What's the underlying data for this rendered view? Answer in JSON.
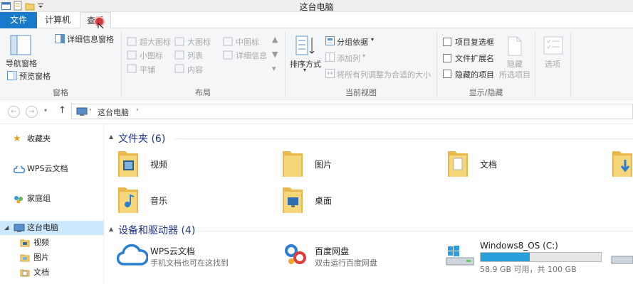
{
  "window": {
    "title": "这台电脑"
  },
  "ribbon_tabs": {
    "file": "文件",
    "computer": "计算机",
    "view": "查看"
  },
  "ribbon": {
    "panes": {
      "nav_pane": "导航窗格",
      "preview_pane": "预览窗格",
      "details_pane": "详细信息窗格",
      "group_label": "窗格"
    },
    "layout": {
      "items": [
        "超大图标",
        "大图标",
        "中图标",
        "小图标",
        "列表",
        "详细信息",
        "平铺",
        "内容"
      ],
      "group_label": "布局"
    },
    "current_view": {
      "sort_by": "排序方式",
      "group_by": "分组依据",
      "add_column": "添加列",
      "fit_columns": "将所有列调整为合适的大小",
      "group_label": "当前视图"
    },
    "show_hide": {
      "item_checkboxes": "项目复选框",
      "file_extensions": "文件扩展名",
      "hidden_items": "隐藏的项目",
      "hide_selected_1": "隐藏",
      "hide_selected_2": "所选项目",
      "group_label": "显示/隐藏"
    },
    "options": {
      "label": "选项"
    }
  },
  "address": {
    "breadcrumb": "这台电脑",
    "separator": "›"
  },
  "nav_pane": {
    "items": [
      "收藏夹",
      "WPS云文档",
      "家庭组",
      "这台电脑",
      "视频",
      "图片",
      "文档"
    ]
  },
  "content": {
    "folders_header": "文件夹 (6)",
    "folders": [
      "视频",
      "图片",
      "文档",
      "音乐",
      "桌面"
    ],
    "devices_header": "设备和驱动器 (4)",
    "devices": [
      {
        "name": "WPS云文档",
        "sub": "手机文档也可在这找到"
      },
      {
        "name": "百度网盘",
        "sub": "双击运行百度网盘"
      },
      {
        "name": "Windows8_OS (C:)",
        "sub": "58.9 GB 可用，共 100 GB",
        "used_fraction": 0.41
      }
    ]
  },
  "colors": {
    "accent": "#1979ca",
    "header_blue": "#1e3287",
    "folder": "#f4d06f",
    "selected": "#cce8ff",
    "drive_fill": "#26a0da"
  }
}
